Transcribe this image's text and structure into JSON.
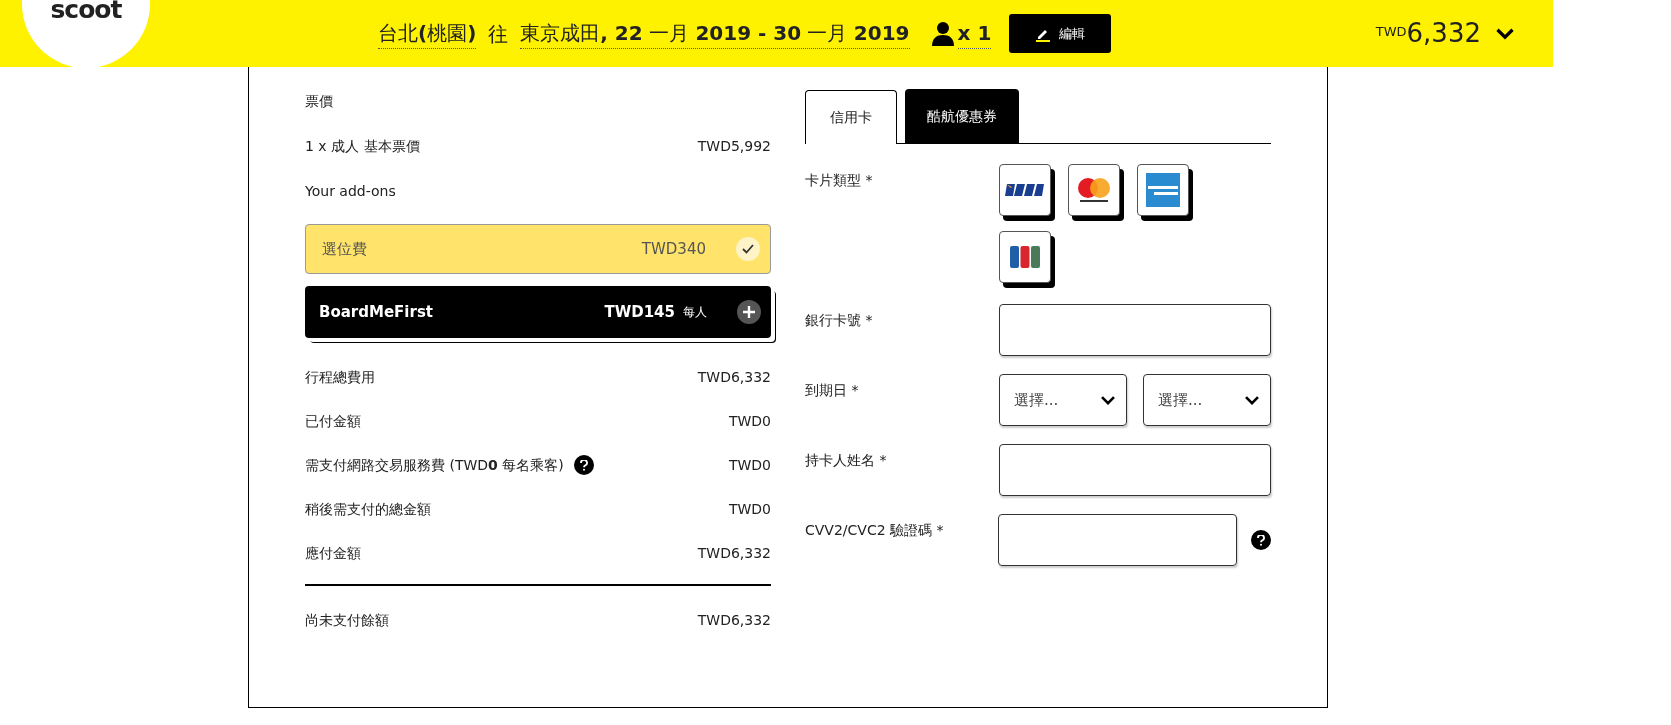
{
  "header": {
    "logo": "scoot",
    "origin": "台北**(**桃園**)**",
    "connector": "往",
    "destination": "東京成田",
    "dates": "**, 22** 一月 **2019 - 30** 一月 **2019**",
    "passengers": "x 1",
    "edit_button": "編輯",
    "currency": "TWD",
    "total": "6,332"
  },
  "fare": {
    "heading": "票價",
    "lines": [
      {
        "label": "1 x 成人 基本票價",
        "amount": "TWD5,992"
      }
    ],
    "addons_heading": "Your add-ons",
    "addons": [
      {
        "name": "選位費",
        "price": "TWD340",
        "added": true
      },
      {
        "name": "BoardMeFirst",
        "price": "TWD145",
        "unit": "每人",
        "added": false
      }
    ],
    "summary": [
      {
        "label": "行程總費用",
        "amount": "TWD6,332",
        "help": false
      },
      {
        "label": "已付金額",
        "amount": "TWD0",
        "help": false
      },
      {
        "label": "需支付網路交易服務費 (TWD**0** 每名乘客)",
        "amount": "TWD0",
        "help": true
      },
      {
        "label": "稍後需支付的總金額",
        "amount": "TWD0",
        "help": false
      },
      {
        "label": "應付金額",
        "amount": "TWD6,332",
        "help": false
      }
    ],
    "balance": {
      "label": "尚未支付餘額",
      "amount": "TWD6,332"
    }
  },
  "payment": {
    "tabs": [
      {
        "label": "信用卡",
        "selected": true
      },
      {
        "label": "酷航優惠券",
        "selected": false
      }
    ],
    "card_type_label": "卡片類型 *",
    "fields": [
      {
        "kind": "text",
        "label": "銀行卡號 *",
        "help": false
      },
      {
        "kind": "selects",
        "label": "到期日 *",
        "placeholders": [
          "選擇...",
          "選擇..."
        ]
      },
      {
        "kind": "text",
        "label": "持卡人姓名 *",
        "help": false
      },
      {
        "kind": "text",
        "label": "CVV2/CVC2 驗證碼 *",
        "help": true
      }
    ]
  }
}
